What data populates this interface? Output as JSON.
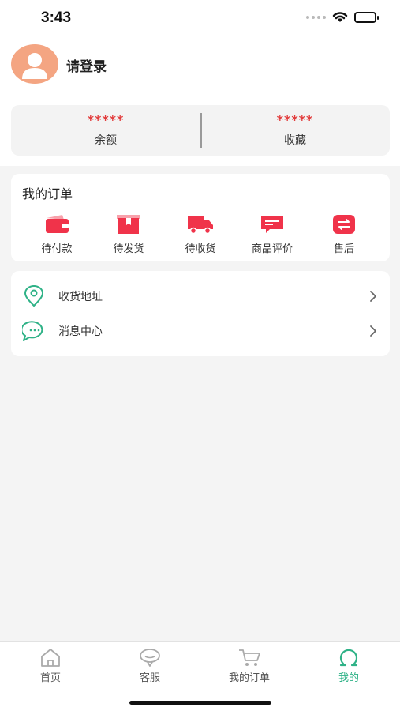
{
  "status_bar": {
    "time": "3:43"
  },
  "profile": {
    "login_label": "请登录"
  },
  "stats": [
    {
      "value": "*****",
      "label": "余额"
    },
    {
      "value": "*****",
      "label": "收藏"
    }
  ],
  "orders": {
    "title": "我的订单",
    "items": [
      {
        "label": "待付款",
        "icon": "wallet-icon"
      },
      {
        "label": "待发货",
        "icon": "package-icon"
      },
      {
        "label": "待收货",
        "icon": "truck-icon"
      },
      {
        "label": "商品评价",
        "icon": "review-icon"
      },
      {
        "label": "售后",
        "icon": "exchange-icon"
      }
    ]
  },
  "menu": [
    {
      "label": "收货地址",
      "icon": "location-icon"
    },
    {
      "label": "消息中心",
      "icon": "message-icon"
    }
  ],
  "tabbar": {
    "items": [
      {
        "label": "首页",
        "icon": "home-icon"
      },
      {
        "label": "客服",
        "icon": "service-icon"
      },
      {
        "label": "我的订单",
        "icon": "cart-icon"
      },
      {
        "label": "我的",
        "icon": "user-icon"
      }
    ],
    "active_index": 3
  },
  "colors": {
    "accent": "#2fb287",
    "price_red": "#e23b3b",
    "icon_red": "#f0334a",
    "avatar_bg": "#f4a582"
  }
}
